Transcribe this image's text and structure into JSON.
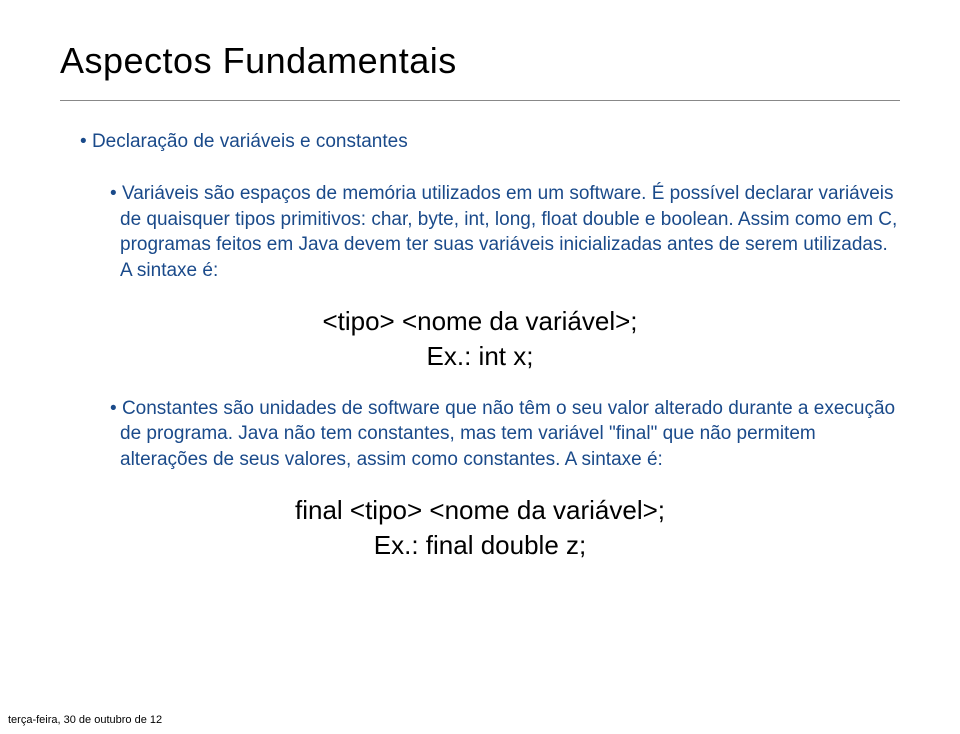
{
  "title": "Aspectos Fundamentais",
  "section_heading": "Declaração de variáveis e constantes",
  "paragraph1": "Variáveis são espaços de memória utilizados em um software. É possível declarar variáveis de quaisquer tipos primitivos: char, byte, int, long, float double e boolean. Assim como em C, programas feitos em Java devem ter suas variáveis inicializadas antes de serem utilizadas. A sintaxe é:",
  "code1_line1": "<tipo> <nome da variável>;",
  "code1_line2": "Ex.: int x;",
  "paragraph2_part1": "Constantes são unidades de software que não têm o seu valor alterado durante a execução de programa. Java não tem constantes, mas tem variável \"",
  "paragraph2_bold": "final",
  "paragraph2_part2": "\" que não permitem alterações de seus valores, assim como constantes. A sintaxe é:",
  "code2_line1": "final <tipo> <nome da variável>;",
  "code2_line2": "Ex.: final double z;",
  "footer": "terça-feira, 30 de outubro de 12"
}
